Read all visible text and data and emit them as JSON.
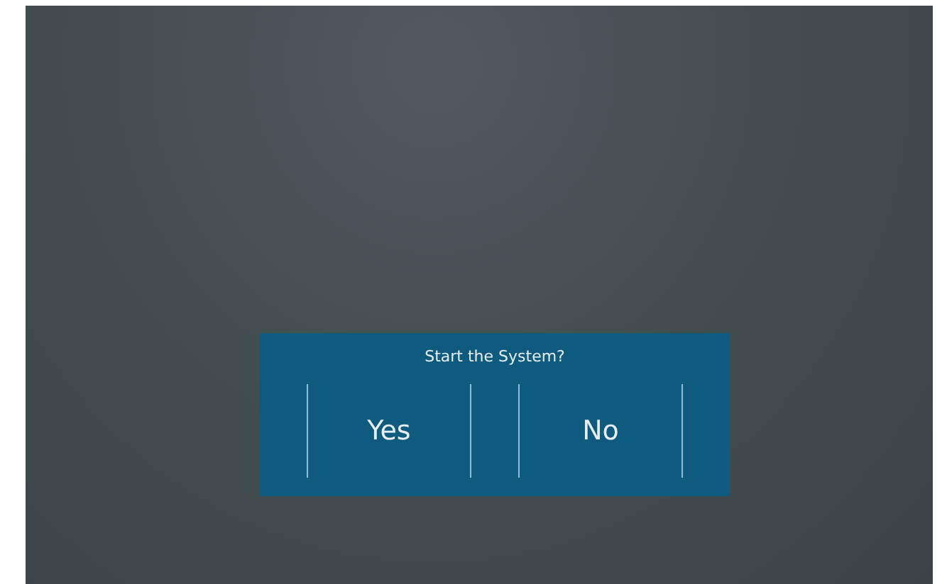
{
  "dialog": {
    "title": "Start the System?",
    "buttons": [
      {
        "label": "Yes"
      },
      {
        "label": "No"
      }
    ]
  }
}
